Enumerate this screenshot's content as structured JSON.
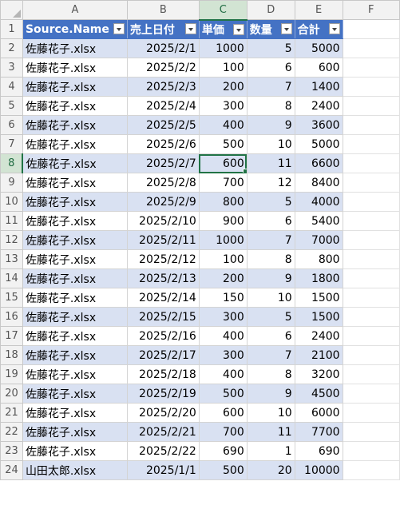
{
  "columns": [
    "A",
    "B",
    "C",
    "D",
    "E",
    "F"
  ],
  "selected_column": "C",
  "selected_row": "8",
  "table_headers": [
    "Source.Name",
    "売上日付",
    "単価",
    "数量",
    "合計"
  ],
  "header_row_number": "1",
  "rows": [
    {
      "n": "2",
      "a": "佐藤花子.xlsx",
      "b": "2025/2/1",
      "c": "1000",
      "d": "5",
      "e": "5000"
    },
    {
      "n": "3",
      "a": "佐藤花子.xlsx",
      "b": "2025/2/2",
      "c": "100",
      "d": "6",
      "e": "600"
    },
    {
      "n": "4",
      "a": "佐藤花子.xlsx",
      "b": "2025/2/3",
      "c": "200",
      "d": "7",
      "e": "1400"
    },
    {
      "n": "5",
      "a": "佐藤花子.xlsx",
      "b": "2025/2/4",
      "c": "300",
      "d": "8",
      "e": "2400"
    },
    {
      "n": "6",
      "a": "佐藤花子.xlsx",
      "b": "2025/2/5",
      "c": "400",
      "d": "9",
      "e": "3600"
    },
    {
      "n": "7",
      "a": "佐藤花子.xlsx",
      "b": "2025/2/6",
      "c": "500",
      "d": "10",
      "e": "5000"
    },
    {
      "n": "8",
      "a": "佐藤花子.xlsx",
      "b": "2025/2/7",
      "c": "600",
      "d": "11",
      "e": "6600"
    },
    {
      "n": "9",
      "a": "佐藤花子.xlsx",
      "b": "2025/2/8",
      "c": "700",
      "d": "12",
      "e": "8400"
    },
    {
      "n": "10",
      "a": "佐藤花子.xlsx",
      "b": "2025/2/9",
      "c": "800",
      "d": "5",
      "e": "4000"
    },
    {
      "n": "11",
      "a": "佐藤花子.xlsx",
      "b": "2025/2/10",
      "c": "900",
      "d": "6",
      "e": "5400"
    },
    {
      "n": "12",
      "a": "佐藤花子.xlsx",
      "b": "2025/2/11",
      "c": "1000",
      "d": "7",
      "e": "7000"
    },
    {
      "n": "13",
      "a": "佐藤花子.xlsx",
      "b": "2025/2/12",
      "c": "100",
      "d": "8",
      "e": "800"
    },
    {
      "n": "14",
      "a": "佐藤花子.xlsx",
      "b": "2025/2/13",
      "c": "200",
      "d": "9",
      "e": "1800"
    },
    {
      "n": "15",
      "a": "佐藤花子.xlsx",
      "b": "2025/2/14",
      "c": "150",
      "d": "10",
      "e": "1500"
    },
    {
      "n": "16",
      "a": "佐藤花子.xlsx",
      "b": "2025/2/15",
      "c": "300",
      "d": "5",
      "e": "1500"
    },
    {
      "n": "17",
      "a": "佐藤花子.xlsx",
      "b": "2025/2/16",
      "c": "400",
      "d": "6",
      "e": "2400"
    },
    {
      "n": "18",
      "a": "佐藤花子.xlsx",
      "b": "2025/2/17",
      "c": "300",
      "d": "7",
      "e": "2100"
    },
    {
      "n": "19",
      "a": "佐藤花子.xlsx",
      "b": "2025/2/18",
      "c": "400",
      "d": "8",
      "e": "3200"
    },
    {
      "n": "20",
      "a": "佐藤花子.xlsx",
      "b": "2025/2/19",
      "c": "500",
      "d": "9",
      "e": "4500"
    },
    {
      "n": "21",
      "a": "佐藤花子.xlsx",
      "b": "2025/2/20",
      "c": "600",
      "d": "10",
      "e": "6000"
    },
    {
      "n": "22",
      "a": "佐藤花子.xlsx",
      "b": "2025/2/21",
      "c": "700",
      "d": "11",
      "e": "7700"
    },
    {
      "n": "23",
      "a": "佐藤花子.xlsx",
      "b": "2025/2/22",
      "c": "690",
      "d": "1",
      "e": "690"
    },
    {
      "n": "24",
      "a": "山田太郎.xlsx",
      "b": "2025/1/1",
      "c": "500",
      "d": "20",
      "e": "10000"
    }
  ],
  "colors": {
    "table_header": "#4472c4",
    "band": "#d9e1f2",
    "selection": "#217346"
  }
}
